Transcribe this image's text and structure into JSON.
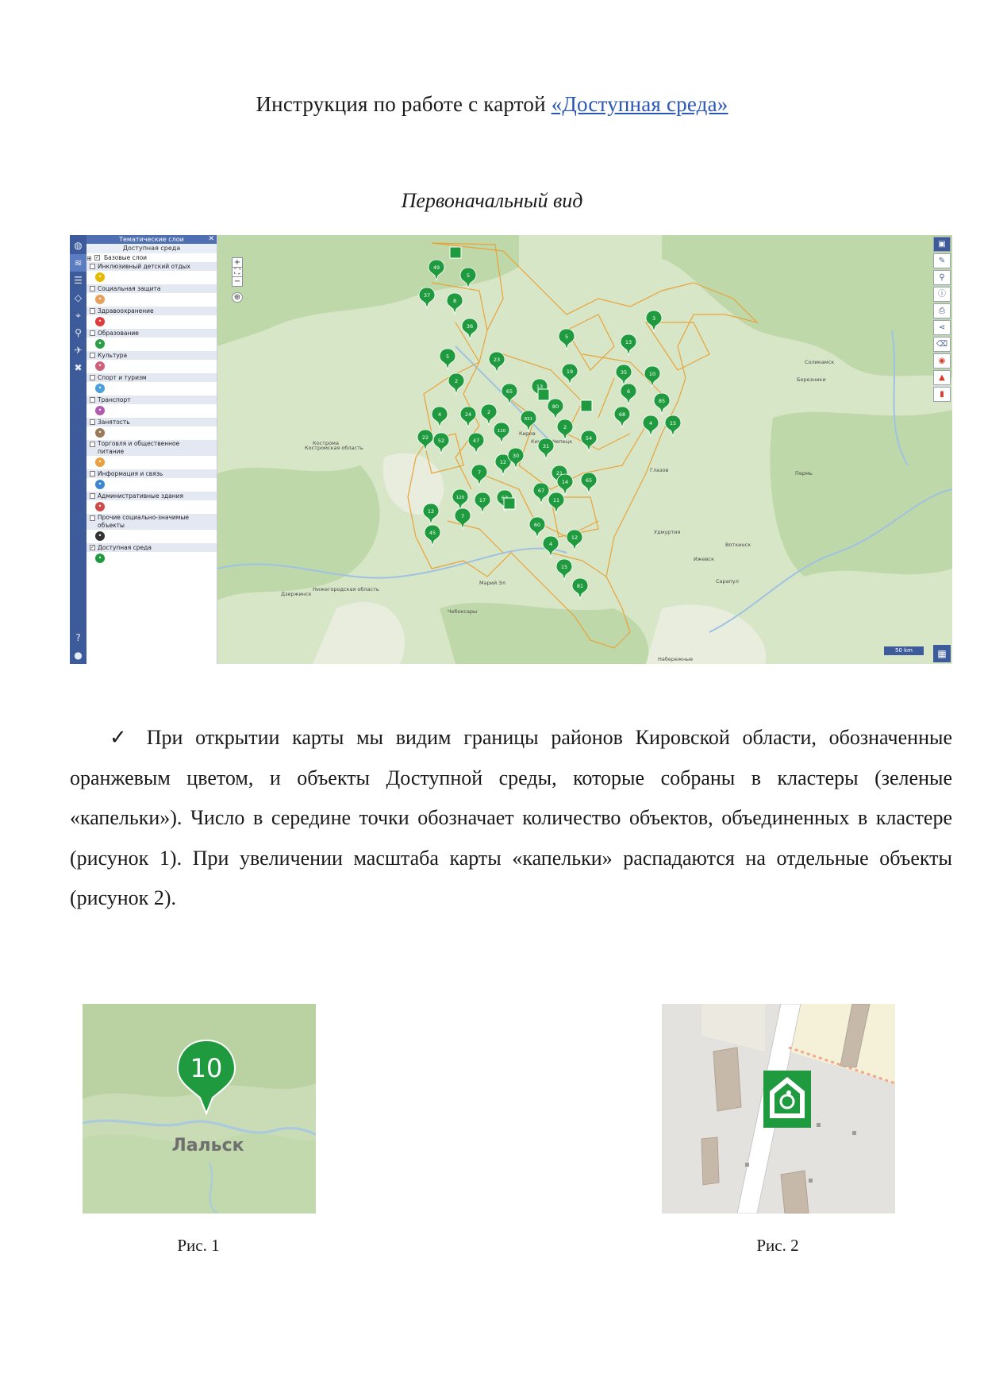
{
  "header": {
    "title_prefix": "Инструкция по работе с картой ",
    "title_link": "«Доступная среда»",
    "subtitle": "Первоначальный вид"
  },
  "map_screenshot": {
    "layers_panel": {
      "title": "Тематические слои",
      "close": "✕",
      "subtitle": "Доступная среда",
      "base_layers": "Базовые слои",
      "items": [
        {
          "label": "Инклюзивный детский отдых",
          "checked": false,
          "icon_color": "#e6b800"
        },
        {
          "label": "Социальная защита",
          "checked": false,
          "icon_color": "#e8a05a"
        },
        {
          "label": "Здравоохранение",
          "checked": false,
          "icon_color": "#e03a3a"
        },
        {
          "label": "Образование",
          "checked": false,
          "icon_color": "#2e9e4a"
        },
        {
          "label": "Культура",
          "checked": false,
          "icon_color": "#d0607a"
        },
        {
          "label": "Спорт и туризм",
          "checked": false,
          "icon_color": "#4aa0d8"
        },
        {
          "label": "Транспорт",
          "checked": false,
          "icon_color": "#b05ab0"
        },
        {
          "label": "Занятость",
          "checked": false,
          "icon_color": "#9a7a5a"
        },
        {
          "label": "Торговля и общественное",
          "label2": "питание",
          "checked": false,
          "icon_color": "#e8a040"
        },
        {
          "label": "Информация и связь",
          "checked": false,
          "icon_color": "#3a86d0"
        },
        {
          "label": "Административные здания",
          "checked": false,
          "icon_color": "#d04a4a"
        },
        {
          "label": "Прочие социально-значимые",
          "label2": "объекты",
          "checked": false,
          "icon_color": "#333333"
        },
        {
          "label": "Доступная среда",
          "checked": true,
          "icon_color": "#1f9a3e"
        }
      ]
    },
    "map": {
      "scale": "50 km",
      "accent": "#3d5b9a",
      "cluster_color": "#1f9a3e",
      "boundary_color": "#e8a33a",
      "city_labels": [
        "Киров",
        "Кирово-Чепецк",
        "Глазов",
        "Пермь",
        "Ижевск",
        "Сарапул",
        "Чебоксары",
        "Набережные",
        "Соликамск",
        "Березники",
        "Кострома",
        "Марий Эл",
        "Удмуртия",
        "Воткинск",
        "Дзержинск",
        "Нижегородская область",
        "Костромская область"
      ],
      "clusters": [
        "49",
        "5",
        "37",
        "8",
        "36",
        "5",
        "23",
        "2",
        "65",
        "13",
        "19",
        "5",
        "3",
        "13",
        "35",
        "10",
        "6",
        "85",
        "68",
        "4",
        "15",
        "4",
        "24",
        "2",
        "651",
        "80",
        "2",
        "22",
        "52",
        "47",
        "110",
        "31",
        "54",
        "12",
        "30",
        "7",
        "21",
        "14",
        "65",
        "120",
        "17",
        "63",
        "67",
        "11",
        "12",
        "7",
        "45",
        "60",
        "12",
        "4",
        "15",
        "81"
      ]
    }
  },
  "body_text": {
    "check": "✓",
    "paragraph": "При открытии карты мы видим границы районов Кировской области, обозначенные оранжевым цветом, и объекты Доступной среды, которые собраны в кластеры (зеленые «капельки»). Число в середине точки обозначает количество объектов, объединенных в кластере (рисунок 1). При увеличении масштаба карты «капельки» распадаются на отдельные объекты (рисунок 2)."
  },
  "figures": {
    "fig1": {
      "cluster_value": "10",
      "place_label": "Лальск",
      "caption": "Рис. 1"
    },
    "fig2": {
      "caption": "Рис. 2"
    }
  }
}
